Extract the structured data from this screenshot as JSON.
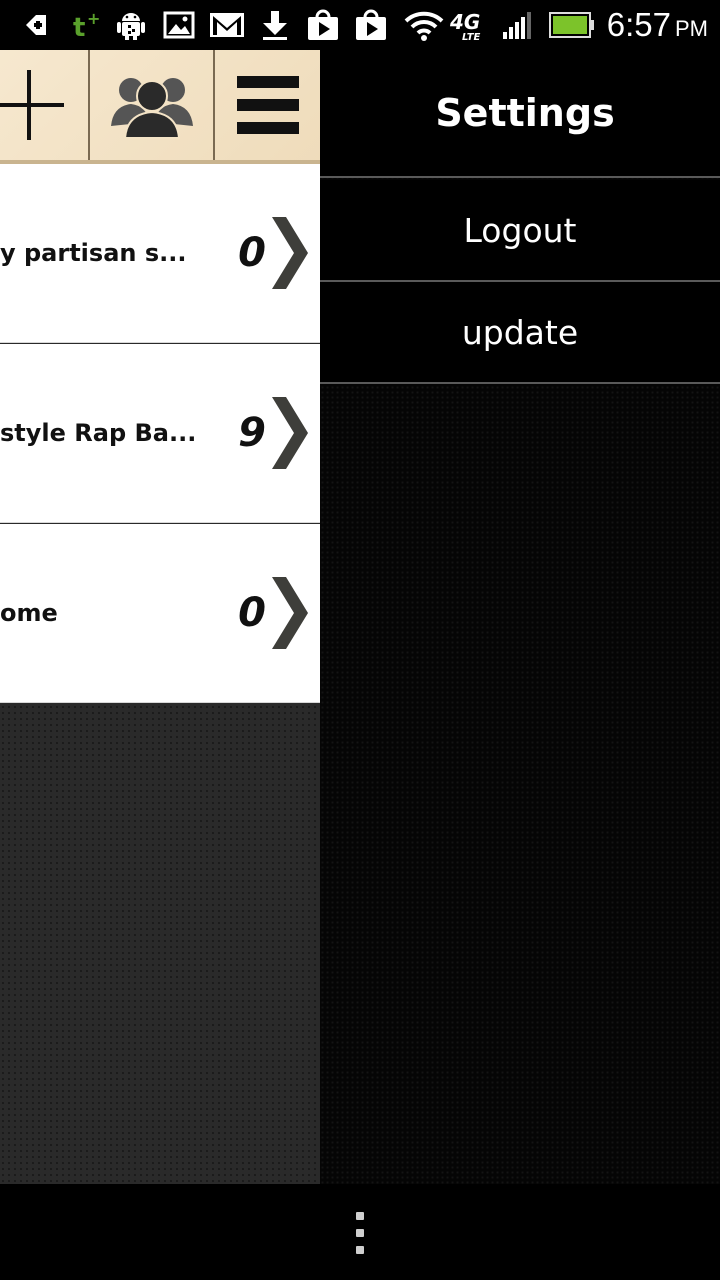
{
  "status_bar": {
    "time": "6:57",
    "ampm": "PM",
    "network": "4G",
    "network_sub": "LTE",
    "icons": [
      "usb-debug-icon",
      "tmobile-icon",
      "android-icon",
      "gallery-icon",
      "gmail-icon",
      "download-icon",
      "play-store-icon",
      "play-store-icon",
      "wifi-icon",
      "4g-lte-icon",
      "signal-icon",
      "battery-icon"
    ]
  },
  "toolbar": {
    "buttons": [
      {
        "icon": "plus-icon"
      },
      {
        "icon": "group-icon"
      },
      {
        "icon": "menu-icon"
      }
    ]
  },
  "list": {
    "rows": [
      {
        "title": "y partisan s...",
        "count": "0"
      },
      {
        "title": "style Rap Ba...",
        "count": "9"
      },
      {
        "title": "ome",
        "count": "0"
      }
    ]
  },
  "settings": {
    "title": "Settings",
    "items": [
      {
        "label": "Logout"
      },
      {
        "label": "update"
      }
    ]
  },
  "colors": {
    "toolbar_bg": "#f3e3c6",
    "chevron": "#3e3e3a",
    "drawer_bg": "#000000"
  }
}
